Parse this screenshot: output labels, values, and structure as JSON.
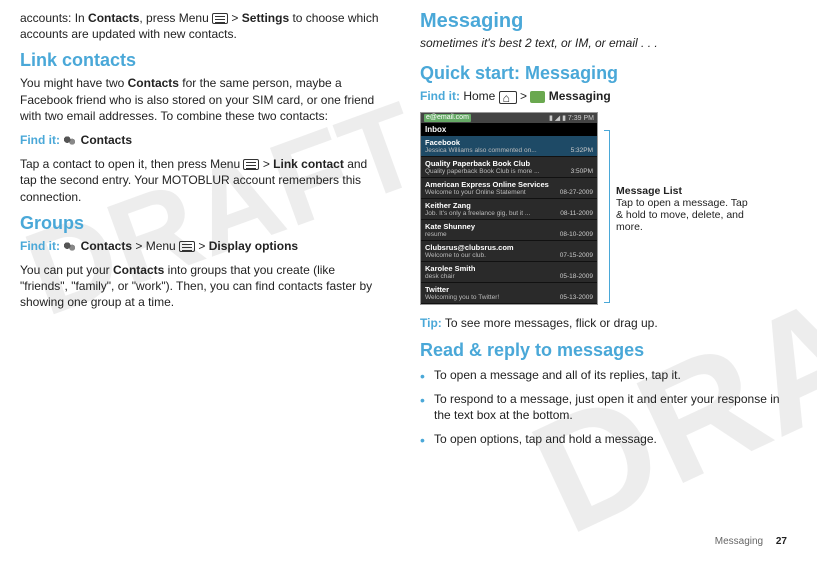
{
  "left": {
    "intro": "accounts: In ",
    "intro_bold1": "Contacts",
    "intro_mid": ", press Menu ",
    "intro_gt": " > ",
    "intro_bold2": "Settings",
    "intro_end": " to choose which accounts are updated with new contacts.",
    "link_title": "Link contacts",
    "link_p1a": "You might have two ",
    "link_p1b": "Contacts",
    "link_p1c": " for the same person, maybe a Facebook friend who is also stored on your SIM card, or one friend with two email addresses. To combine these two contacts:",
    "findit1_label": "Find it:",
    "findit1_text": "Contacts",
    "link_p2a": "Tap a contact to open it, then press Menu ",
    "link_p2b": " > ",
    "link_p2c": "Link contact",
    "link_p2d": " and tap the second entry. Your MOTOBLUR account remembers this connection.",
    "groups_title": "Groups",
    "findit2_label": "Find it:",
    "findit2_text1": "Contacts",
    "findit2_mid": " > Menu ",
    "findit2_gt": " > ",
    "findit2_text2": "Display options",
    "groups_p1a": "You can put your ",
    "groups_p1b": "Contacts",
    "groups_p1c": " into groups that you create (like \"friends\", \"family\", or \"work\"). Then, you can find contacts faster by showing one group at a time."
  },
  "right": {
    "chapter": "Messaging",
    "subtitle": "sometimes it's best 2 text, or IM, or email . . .",
    "quick_title": "Quick start: Messaging",
    "findit_label": "Find it:",
    "findit_home": " Home ",
    "findit_gt": " > ",
    "findit_msg": "Messaging",
    "statusbar_email": "e@email.com",
    "statusbar_time": "7:39 PM",
    "inbox_label": "Inbox",
    "messages": [
      {
        "sender": "Facebook",
        "preview": "Jessica Williams also commented on...",
        "date": "5:32PM",
        "sel": true
      },
      {
        "sender": "Quality Paperback Book Club",
        "preview": "Quality paperback Book Club is more ...",
        "date": "3:50PM"
      },
      {
        "sender": "American Express Online Services",
        "preview": "Welcome to your Online Statement",
        "date": "08-27-2009"
      },
      {
        "sender": "Keither Zang",
        "preview": "Job. It's only a freelance gig, but it ...",
        "date": "08-11-2009"
      },
      {
        "sender": "Kate Shunney",
        "preview": "resume",
        "date": "08-10-2009"
      },
      {
        "sender": "Clubsrus@clubsrus.com",
        "preview": "Welcome to our club.",
        "date": "07-15-2009"
      },
      {
        "sender": "Karolee Smith",
        "preview": "desk chair",
        "date": "05-18-2009"
      },
      {
        "sender": "Twitter",
        "preview": "Welcoming you to Twitter!",
        "date": "05-13-2009"
      }
    ],
    "callout_title": "Message List",
    "callout_text": "Tap to open a message. Tap & hold to move, delete, and more.",
    "tip_label": "Tip:",
    "tip_text": " To see more messages, flick or drag up.",
    "read_title": "Read & reply to messages",
    "bullets": [
      "To open a message and all of its replies, tap it.",
      "To respond to a message, just open it and enter your response in the text box at the bottom.",
      "To open options, tap and hold a message."
    ]
  },
  "footer": {
    "section": "Messaging",
    "page": "27"
  }
}
